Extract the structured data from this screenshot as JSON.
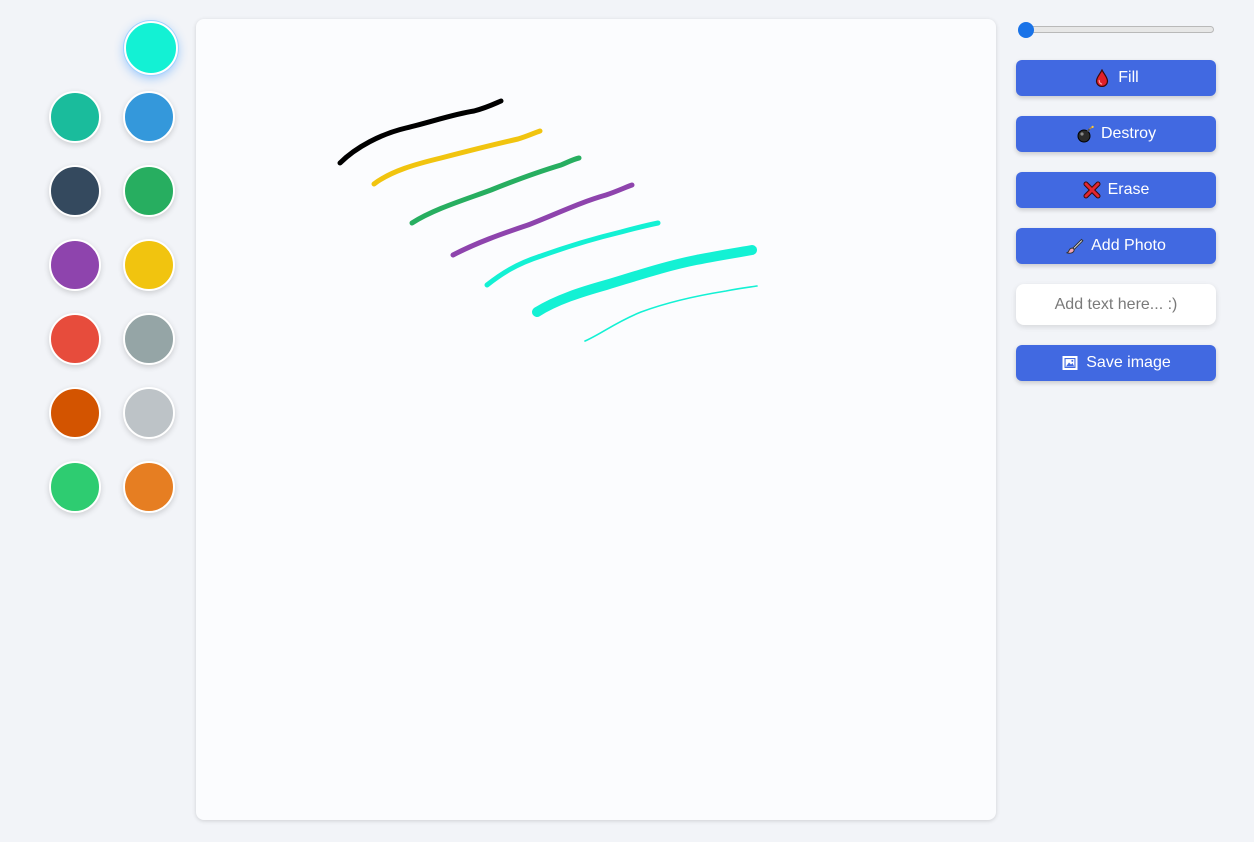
{
  "palette": {
    "selected": "#13f1d4",
    "colors": [
      "#13f1d4",
      "#1abc9c",
      "#3498db",
      "#34495e",
      "#27ae60",
      "#8e44ad",
      "#f1c40f",
      "#e74c3c",
      "#95a5a6",
      "#d35400",
      "#bdc3c7",
      "#2ecc71",
      "#e67e22"
    ]
  },
  "brush": {
    "size_slider_value": 0
  },
  "toolbar": {
    "fill_label": "Fill",
    "fill_icon": "drop-icon",
    "destroy_label": "Destroy",
    "destroy_icon": "bomb-icon",
    "erase_label": "Erase",
    "erase_icon": "cross-mark-icon",
    "add_photo_label": "Add Photo",
    "add_photo_icon": "paintbrush-icon",
    "text_placeholder": "Add text here... :)",
    "text_value": "",
    "save_label": "Save image",
    "save_icon": "framed-picture-icon"
  },
  "canvas": {
    "background": "#fbfcfe",
    "strokes": [
      {
        "color": "#000000"
      },
      {
        "color": "#f1c40f"
      },
      {
        "color": "#27ae60"
      },
      {
        "color": "#8e44ad"
      },
      {
        "color": "#13f1d4"
      },
      {
        "color": "#13f1d4"
      },
      {
        "color": "#13f1d4"
      }
    ]
  }
}
